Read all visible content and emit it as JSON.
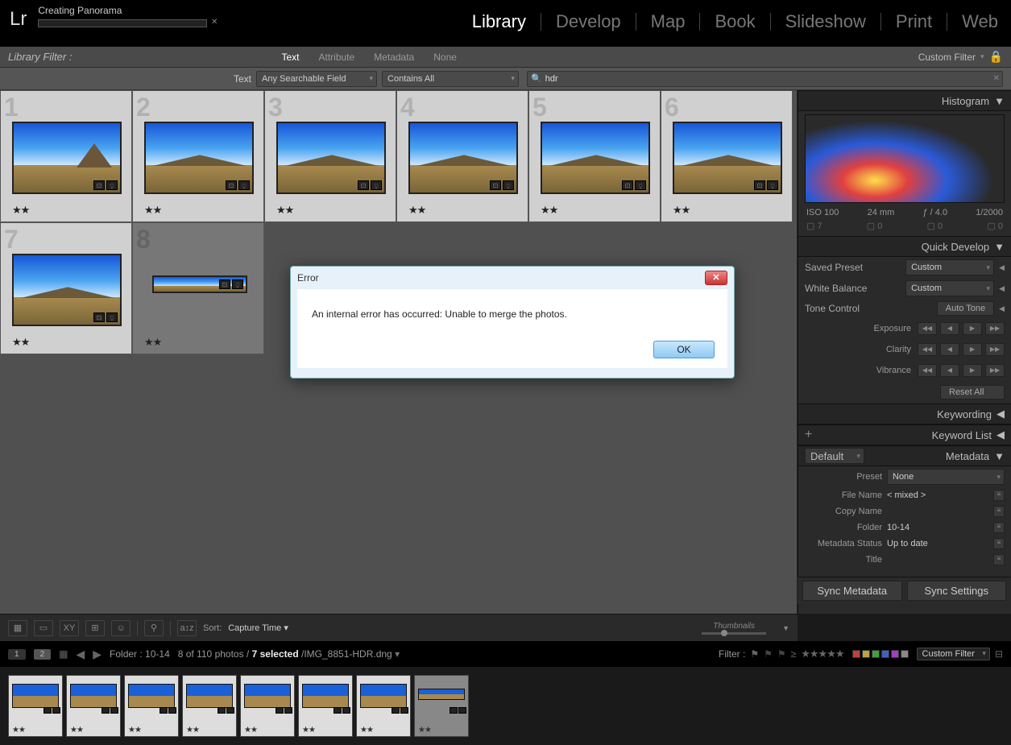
{
  "task": {
    "title": "Creating Panorama"
  },
  "modules": [
    "Library",
    "Develop",
    "Map",
    "Book",
    "Slideshow",
    "Print",
    "Web"
  ],
  "active_module": "Library",
  "library_filter": {
    "label": "Library Filter :",
    "tabs": [
      "Text",
      "Attribute",
      "Metadata",
      "None"
    ],
    "active_tab": "Text",
    "right_label": "Custom Filter"
  },
  "search": {
    "label": "Text",
    "field_select": "Any Searchable Field",
    "match_select": "Contains All",
    "query": "hdr"
  },
  "grid": {
    "thumbs": [
      {
        "idx": 1,
        "rating": "★★",
        "mountain": "big",
        "selected": true
      },
      {
        "idx": 2,
        "rating": "★★",
        "mountain": "low",
        "selected": true
      },
      {
        "idx": 3,
        "rating": "★★",
        "mountain": "low",
        "selected": true
      },
      {
        "idx": 4,
        "rating": "★★",
        "mountain": "low",
        "selected": true
      },
      {
        "idx": 5,
        "rating": "★★",
        "mountain": "low",
        "selected": true
      },
      {
        "idx": 6,
        "rating": "★★",
        "mountain": "low",
        "selected": true
      },
      {
        "idx": 7,
        "rating": "★★",
        "mountain": "low",
        "selected": true
      },
      {
        "idx": 8,
        "rating": "★★",
        "mountain": "tiny",
        "selected": false
      }
    ]
  },
  "histogram": {
    "title": "Histogram",
    "info": [
      "ISO 100",
      "24 mm",
      "ƒ / 4.0",
      "1/2000"
    ],
    "row2": [
      "7",
      "0",
      "0",
      "0"
    ]
  },
  "quick_develop": {
    "title": "Quick Develop",
    "saved_preset": {
      "label": "Saved Preset",
      "value": "Custom"
    },
    "white_balance": {
      "label": "White Balance",
      "value": "Custom"
    },
    "tone_control": {
      "label": "Tone Control",
      "button": "Auto Tone"
    },
    "adjustments": [
      "Exposure",
      "Clarity",
      "Vibrance"
    ],
    "reset": "Reset All"
  },
  "keywording": {
    "title": "Keywording"
  },
  "keyword_list": {
    "title": "Keyword List"
  },
  "metadata": {
    "title": "Metadata",
    "mode": "Default",
    "preset_label": "Preset",
    "preset_value": "None",
    "rows": [
      {
        "label": "File Name",
        "value": "< mixed >"
      },
      {
        "label": "Copy Name",
        "value": ""
      },
      {
        "label": "Folder",
        "value": "10-14"
      },
      {
        "label": "Metadata Status",
        "value": "Up to date"
      },
      {
        "label": "Title",
        "value": ""
      }
    ]
  },
  "under_toolbar": {
    "sort_label": "Sort:",
    "sort_value": "Capture Time",
    "thumbnails_label": "Thumbnails"
  },
  "sync": {
    "metadata": "Sync Metadata",
    "settings": "Sync Settings"
  },
  "bottom": {
    "folder": "Folder : 10-14",
    "count": "8 of 110 photos /",
    "selected": "7 selected",
    "file": "/IMG_8851-HDR.dng",
    "filter_label": "Filter :",
    "custom_filter": "Custom Filter",
    "colors": [
      "#c04040",
      "#c0a040",
      "#40a040",
      "#4060c0",
      "#a040c0",
      "#888"
    ],
    "pages": [
      "1",
      "2"
    ]
  },
  "filmstrip": {
    "items": [
      {
        "rating": "★★",
        "sel": true
      },
      {
        "rating": "★★",
        "sel": true
      },
      {
        "rating": "★★",
        "sel": true
      },
      {
        "rating": "★★",
        "sel": true
      },
      {
        "rating": "★★",
        "sel": true
      },
      {
        "rating": "★★",
        "sel": true
      },
      {
        "rating": "★★",
        "sel": true
      },
      {
        "rating": "★★",
        "sel": false,
        "tiny": true
      }
    ]
  },
  "error": {
    "title": "Error",
    "message": "An internal error has occurred: Unable to merge the photos.",
    "ok": "OK"
  }
}
